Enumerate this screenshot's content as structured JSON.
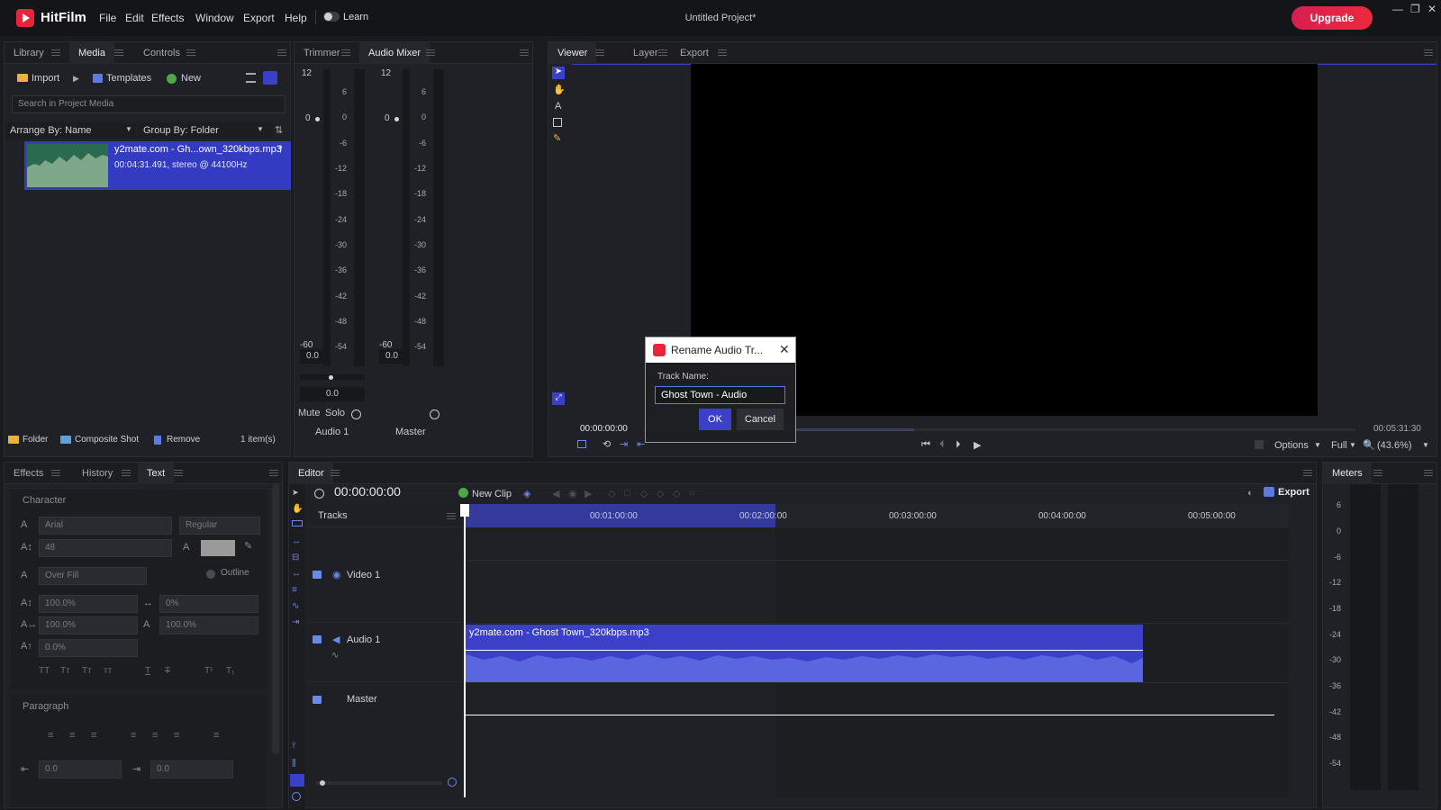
{
  "app": {
    "name": "HitFilm",
    "project_title": "Untitled Project*",
    "upgrade_label": "Upgrade",
    "learn_label": "Learn"
  },
  "menu": [
    "File",
    "Edit",
    "Effects",
    "Window",
    "Export",
    "Help"
  ],
  "left_panel": {
    "tabs": [
      "Library",
      "Media",
      "Controls"
    ],
    "toolbar": {
      "import": "Import",
      "templates": "Templates",
      "new": "New"
    },
    "search_placeholder": "Search in Project Media",
    "arrange": "Arrange By: Name",
    "group": "Group By: Folder",
    "media_item": {
      "name": "y2mate.com - Gh...own_320kbps.mp3",
      "info": "00:04:31.491, stereo @ 44100Hz"
    },
    "footer": {
      "folder": "Folder",
      "composite": "Composite Shot",
      "remove": "Remove",
      "count": "1 item(s)"
    }
  },
  "mixer_panel": {
    "tabs": [
      "Trimmer",
      "Audio Mixer"
    ],
    "scale": [
      "12",
      "6",
      "0",
      "-6",
      "-12",
      "-18",
      "-24",
      "-30",
      "-36",
      "-42",
      "-48",
      "-54"
    ],
    "channel1": {
      "top": "12",
      "zero": "0",
      "bottom": "-60",
      "value": "0.0",
      "name": "Audio 1",
      "pan": "0.0"
    },
    "channel2": {
      "top": "12",
      "zero": "0",
      "bottom": "-60",
      "value": "0.0",
      "name": "Master"
    },
    "mute": "Mute",
    "solo": "Solo"
  },
  "viewer_panel": {
    "tabs": [
      "Viewer",
      "Layer",
      "Export"
    ],
    "timecode_left": "00:00:00:00",
    "timecode_right": "00:05:31:30",
    "options": "Options",
    "quality": "Full",
    "zoom": "(43.6%)"
  },
  "dialog": {
    "title": "Rename Audio Tr...",
    "label": "Track Name:",
    "value": "Ghost Town - Audio",
    "ok": "OK",
    "cancel": "Cancel"
  },
  "text_panel": {
    "tabs": [
      "Effects",
      "History",
      "Text"
    ],
    "character_header": "Character",
    "font": "Arial",
    "style": "Regular",
    "size": "48",
    "fill": "Over Fill",
    "outline": "Outline",
    "vscale": "100.0%",
    "tracking": "0%",
    "hscale": "100.0%",
    "opacity": "100.0%",
    "baseline": "0.0%",
    "case_buttons": [
      "TT",
      "Tт",
      "Tт",
      "тт",
      "T",
      "T",
      "T¹",
      "T₁"
    ],
    "paragraph_header": "Paragraph",
    "indent_left": "0.0",
    "indent_right": "0.0"
  },
  "editor": {
    "tab": "Editor",
    "timecode": "00:00:00:00",
    "new_clip": "New Clip",
    "export": "Export",
    "tracks_label": "Tracks",
    "ruler": [
      "00:01:00:00",
      "00:02:00:00",
      "00:03:00:00",
      "00:04:00:00",
      "00:05:00:00"
    ],
    "tracks": {
      "video": "Video 1",
      "audio": "Audio 1",
      "master": "Master"
    },
    "clip_name": "y2mate.com - Ghost Town_320kbps.mp3"
  },
  "meters": {
    "tab": "Meters",
    "scale": [
      "6",
      "0",
      "-6",
      "-12",
      "-18",
      "-24",
      "-30",
      "-36",
      "-42",
      "-48",
      "-54"
    ]
  },
  "colors": {
    "accent": "#3a40c8",
    "brand": "#e8233b",
    "bg": "#1a1b1f"
  }
}
